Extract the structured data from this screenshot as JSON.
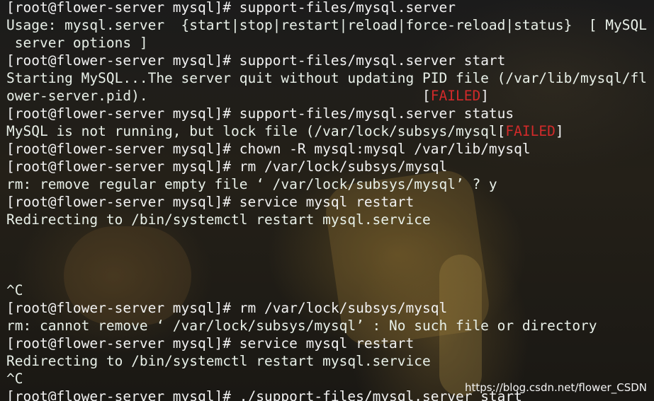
{
  "terminal": {
    "prompt": "[root@flower-server mysql]# ",
    "lines": [
      {
        "cmd": "support-files/mysql.server"
      },
      {
        "text": "Usage: mysql.server  {start|stop|restart|reload|force-reload|status}  [ MySQL"
      },
      {
        "text": " server options ]"
      },
      {
        "cmd": "support-files/mysql.server start"
      },
      {
        "text": "Starting MySQL...The server quit without updating PID file (/var/lib/mysql/fl"
      },
      {
        "text": "ower-server.pid).                                 ",
        "status": "FAILED"
      },
      {
        "cmd": "support-files/mysql.server status"
      },
      {
        "text": "MySQL is not running, but lock file (/var/lock/subsys/mysql",
        "status": "FAILED"
      },
      {
        "cmd": "chown -R mysql:mysql /var/lib/mysql"
      },
      {
        "cmd": "rm /var/lock/subsys/mysql"
      },
      {
        "text": "rm: remove regular empty file ‘ /var/lock/subsys/mysql’ ? y"
      },
      {
        "cmd": "service mysql restart"
      },
      {
        "text": "Redirecting to /bin/systemctl restart mysql.service"
      },
      {
        "text": ""
      },
      {
        "text": ""
      },
      {
        "text": ""
      },
      {
        "text": "^C"
      },
      {
        "cmd": "rm /var/lock/subsys/mysql"
      },
      {
        "text": "rm: cannot remove ‘ /var/lock/subsys/mysql’ : No such file or directory"
      },
      {
        "cmd": "service mysql restart"
      },
      {
        "text": "Redirecting to /bin/systemctl restart mysql.service"
      },
      {
        "text": "^C"
      },
      {
        "cmd": "./support-files/mysql.server start"
      }
    ]
  },
  "watermark": "https://blog.csdn.net/flower_CSDN",
  "colors": {
    "text": "#ecf0ee",
    "failed": "#d22a2a"
  }
}
